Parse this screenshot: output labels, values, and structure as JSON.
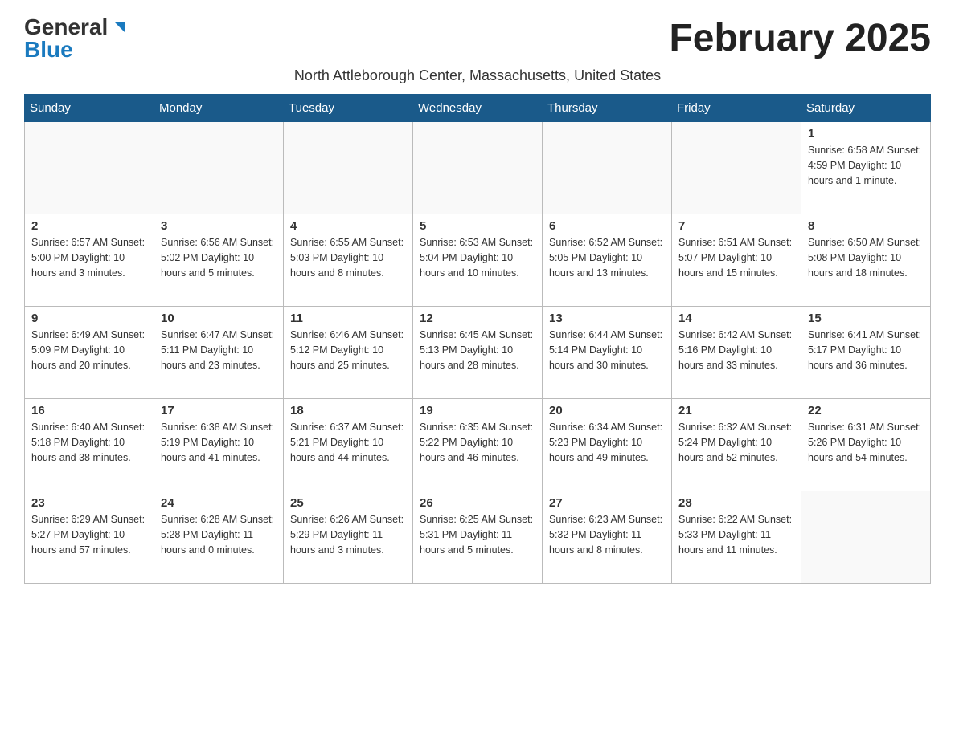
{
  "header": {
    "logo_general": "General",
    "logo_blue": "Blue",
    "month_title": "February 2025",
    "subtitle": "North Attleborough Center, Massachusetts, United States"
  },
  "days_of_week": [
    "Sunday",
    "Monday",
    "Tuesday",
    "Wednesday",
    "Thursday",
    "Friday",
    "Saturday"
  ],
  "weeks": [
    [
      {
        "day": "",
        "info": ""
      },
      {
        "day": "",
        "info": ""
      },
      {
        "day": "",
        "info": ""
      },
      {
        "day": "",
        "info": ""
      },
      {
        "day": "",
        "info": ""
      },
      {
        "day": "",
        "info": ""
      },
      {
        "day": "1",
        "info": "Sunrise: 6:58 AM\nSunset: 4:59 PM\nDaylight: 10 hours\nand 1 minute."
      }
    ],
    [
      {
        "day": "2",
        "info": "Sunrise: 6:57 AM\nSunset: 5:00 PM\nDaylight: 10 hours\nand 3 minutes."
      },
      {
        "day": "3",
        "info": "Sunrise: 6:56 AM\nSunset: 5:02 PM\nDaylight: 10 hours\nand 5 minutes."
      },
      {
        "day": "4",
        "info": "Sunrise: 6:55 AM\nSunset: 5:03 PM\nDaylight: 10 hours\nand 8 minutes."
      },
      {
        "day": "5",
        "info": "Sunrise: 6:53 AM\nSunset: 5:04 PM\nDaylight: 10 hours\nand 10 minutes."
      },
      {
        "day": "6",
        "info": "Sunrise: 6:52 AM\nSunset: 5:05 PM\nDaylight: 10 hours\nand 13 minutes."
      },
      {
        "day": "7",
        "info": "Sunrise: 6:51 AM\nSunset: 5:07 PM\nDaylight: 10 hours\nand 15 minutes."
      },
      {
        "day": "8",
        "info": "Sunrise: 6:50 AM\nSunset: 5:08 PM\nDaylight: 10 hours\nand 18 minutes."
      }
    ],
    [
      {
        "day": "9",
        "info": "Sunrise: 6:49 AM\nSunset: 5:09 PM\nDaylight: 10 hours\nand 20 minutes."
      },
      {
        "day": "10",
        "info": "Sunrise: 6:47 AM\nSunset: 5:11 PM\nDaylight: 10 hours\nand 23 minutes."
      },
      {
        "day": "11",
        "info": "Sunrise: 6:46 AM\nSunset: 5:12 PM\nDaylight: 10 hours\nand 25 minutes."
      },
      {
        "day": "12",
        "info": "Sunrise: 6:45 AM\nSunset: 5:13 PM\nDaylight: 10 hours\nand 28 minutes."
      },
      {
        "day": "13",
        "info": "Sunrise: 6:44 AM\nSunset: 5:14 PM\nDaylight: 10 hours\nand 30 minutes."
      },
      {
        "day": "14",
        "info": "Sunrise: 6:42 AM\nSunset: 5:16 PM\nDaylight: 10 hours\nand 33 minutes."
      },
      {
        "day": "15",
        "info": "Sunrise: 6:41 AM\nSunset: 5:17 PM\nDaylight: 10 hours\nand 36 minutes."
      }
    ],
    [
      {
        "day": "16",
        "info": "Sunrise: 6:40 AM\nSunset: 5:18 PM\nDaylight: 10 hours\nand 38 minutes."
      },
      {
        "day": "17",
        "info": "Sunrise: 6:38 AM\nSunset: 5:19 PM\nDaylight: 10 hours\nand 41 minutes."
      },
      {
        "day": "18",
        "info": "Sunrise: 6:37 AM\nSunset: 5:21 PM\nDaylight: 10 hours\nand 44 minutes."
      },
      {
        "day": "19",
        "info": "Sunrise: 6:35 AM\nSunset: 5:22 PM\nDaylight: 10 hours\nand 46 minutes."
      },
      {
        "day": "20",
        "info": "Sunrise: 6:34 AM\nSunset: 5:23 PM\nDaylight: 10 hours\nand 49 minutes."
      },
      {
        "day": "21",
        "info": "Sunrise: 6:32 AM\nSunset: 5:24 PM\nDaylight: 10 hours\nand 52 minutes."
      },
      {
        "day": "22",
        "info": "Sunrise: 6:31 AM\nSunset: 5:26 PM\nDaylight: 10 hours\nand 54 minutes."
      }
    ],
    [
      {
        "day": "23",
        "info": "Sunrise: 6:29 AM\nSunset: 5:27 PM\nDaylight: 10 hours\nand 57 minutes."
      },
      {
        "day": "24",
        "info": "Sunrise: 6:28 AM\nSunset: 5:28 PM\nDaylight: 11 hours\nand 0 minutes."
      },
      {
        "day": "25",
        "info": "Sunrise: 6:26 AM\nSunset: 5:29 PM\nDaylight: 11 hours\nand 3 minutes."
      },
      {
        "day": "26",
        "info": "Sunrise: 6:25 AM\nSunset: 5:31 PM\nDaylight: 11 hours\nand 5 minutes."
      },
      {
        "day": "27",
        "info": "Sunrise: 6:23 AM\nSunset: 5:32 PM\nDaylight: 11 hours\nand 8 minutes."
      },
      {
        "day": "28",
        "info": "Sunrise: 6:22 AM\nSunset: 5:33 PM\nDaylight: 11 hours\nand 11 minutes."
      },
      {
        "day": "",
        "info": ""
      }
    ]
  ]
}
